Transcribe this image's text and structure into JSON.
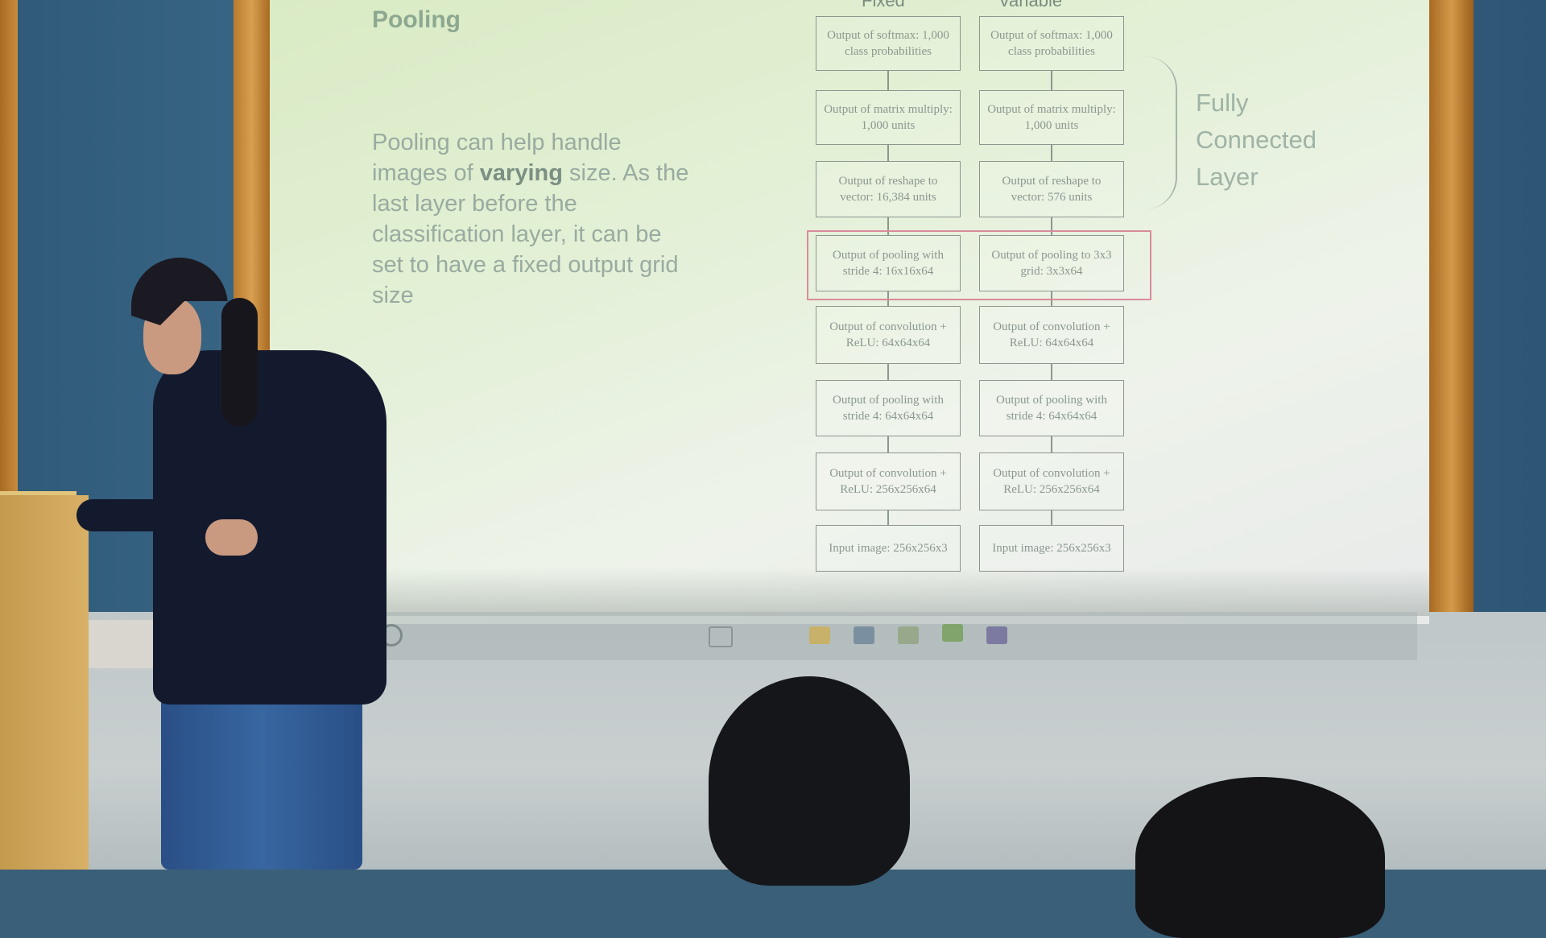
{
  "slide": {
    "title": "Pooling",
    "body_part1": "Pooling can help handle images of ",
    "body_bold": "varying",
    "body_part2": " size. As the last layer before the classification layer, it can be set to have a fixed output grid size",
    "fc_label": "Fully Connected Layer"
  },
  "diagram": {
    "left_column_header": "Fixed",
    "right_column_header": "Variable",
    "left_boxes": [
      "Output of softmax: 1,000 class probabilities",
      "Output of matrix multiply: 1,000 units",
      "Output of reshape to vector: 16,384 units",
      "Output of pooling with stride 4: 16x16x64",
      "Output of convolution + ReLU: 64x64x64",
      "Output of pooling with stride 4: 64x64x64",
      "Output of convolution + ReLU: 256x256x64",
      "Input image: 256x256x3"
    ],
    "right_boxes": [
      "Output of softmax: 1,000 class probabilities",
      "Output of matrix multiply: 1,000 units",
      "Output of reshape to vector: 576 units",
      "Output of pooling to 3x3 grid: 3x3x64",
      "Output of convolution + ReLU: 64x64x64",
      "Output of pooling with stride 4: 64x64x64",
      "Output of convolution + ReLU: 256x256x64",
      "Input image: 256x256x3"
    ]
  },
  "colors": {
    "highlight": "#d98b9b",
    "screen": "#e3f0d6"
  }
}
